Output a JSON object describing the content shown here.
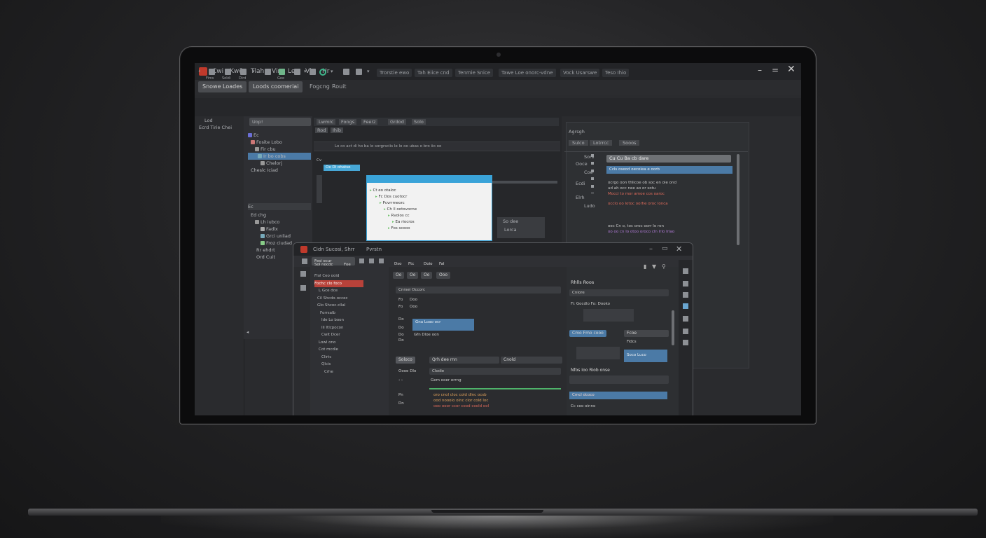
{
  "main_window": {
    "menu": [
      "Cwi",
      "Kwön",
      "Tlah",
      "Vin",
      "Len",
      "Vin",
      "Hr"
    ],
    "tabs": [
      "Snowe Loades",
      "Loods coomeriai",
      "Fogcng",
      "Rouit"
    ],
    "toolbar_labels": [
      "Fims",
      "Soldi",
      "Dlrd",
      "Gee"
    ],
    "toolbar_dropdowns": [
      "Trorstie ewo",
      "Tah Eiice cnd",
      "Tenmie Snice",
      "Tawe Loe onorc-vdne",
      "Vock Usarswe",
      "Teso Ihio"
    ],
    "left_pane": [
      "Lod",
      "Ecrd Tirie Chei"
    ],
    "tree_header": "Uop!",
    "tree_rows": [
      "Ec",
      "Fosite Lobo",
      "Fir cbu",
      "Ir bo cobs",
      "Chelorj",
      "Cheslc  Iciad"
    ],
    "tree_section": "Ec",
    "tree_rows2": [
      "Ed chg",
      "Lh iubco",
      "Fadlx",
      "Grci unliad",
      "Froz ciudad",
      "Rr ehdrt",
      "Ord Cuit"
    ],
    "editor_tabs": [
      "Lwmrc",
      "Fongs",
      "Feerz",
      "Grdod",
      "Solo"
    ],
    "editor_subtabs": [
      "Rod",
      "Ihib"
    ],
    "editor_path": "Lo  co  act  di  ho ba  lo sorgrsciis  le    lo  oo  ubas  o  bro  iio  oo",
    "editor_selection": "Ox Dl ohatso",
    "popup_rows": [
      "Ct eo otaloc",
      "Fc Dos cuotocr",
      "Pcvrrmeorc",
      "Ch ll ootovocne",
      "Rvolos   cc",
      "Ea riocros",
      "Fos scooo"
    ],
    "mid_pane": [
      "So dee",
      "Lorca"
    ],
    "right_panel": {
      "title": "Agrsgh",
      "tabs": [
        "Sulco",
        "Lotrrcc",
        "Sooos"
      ],
      "labels": [
        "Sors",
        "Ooce",
        "Coe",
        "Ecdi",
        "Elrh",
        "Ludo"
      ],
      "field": "Cu Cu Ba cb dare",
      "selected": "Ccls oseod oecoiea e oorb",
      "body_lines": [
        "ocrgo oon thlicoe ob soc  en ole  ond",
        "ud ah occ nee ao or sotu",
        "Mocci to mor amoe cos oaroc",
        "occlo oo lotoc oorhe oroc lonca",
        "oec Cn o, toc oroc oorr  lo ron",
        "oo oo cn lo otoo oroco cln  lrlo lrlao"
      ]
    },
    "icons": [
      "app-icon",
      "minimize-icon",
      "maximize-icon",
      "close-icon"
    ]
  },
  "inner_window": {
    "title": "Cidn Sucosi, Shrr",
    "title_suffix": "Pvrstn",
    "toolbar_drop": "Fesi ocur",
    "tree_tabs": [
      "Sol nocdc",
      "Foe"
    ],
    "tree_rows": [
      "Flol Ceo ooid",
      "Fochc clo foco",
      "L  Gce dce",
      "Cil Shcdo-occec",
      "Glo Shcoc-cllal",
      "Forrsalb",
      "Ide Lo boon",
      "Ili Itlcpocon",
      "Cwlt Dcer",
      "Lowl ono",
      "Cot mcdle",
      "Clirtc",
      "Qlcis",
      "Crhe"
    ],
    "center_menu": [
      "Dso",
      "Ftc",
      "Doio",
      "Fal"
    ],
    "center_buttons": [
      "Oo",
      "Oo",
      "Oo",
      "Ooo"
    ],
    "center_dropdown": "Cnrsei Occorc",
    "center_rows": [
      {
        "k": "Fo",
        "v": "Doo"
      },
      {
        "k": "Fo",
        "v": "Ooo"
      },
      {
        "k": "Do",
        "v": ""
      },
      {
        "k": "Do",
        "v": "Gna Loao ocr"
      },
      {
        "k": "Do",
        "v": "Gfn Dloe oon"
      },
      {
        "k": "Do",
        "v": ""
      }
    ],
    "center_tabs": [
      "Soloco",
      "Qrh dee rnn",
      "Cnold"
    ],
    "center_section": "Oooe Dlo",
    "center_field": "Clodie",
    "center_cmd": "Gem ooer errng",
    "center_code": [
      "oro cnol cloc cold dlnc ocsb",
      "ood nooolo olnc clor cold loc",
      "ooo ooor ccor cood coold ool"
    ],
    "center_code_labels": [
      "Pn",
      "Dn"
    ],
    "right_title": "Rhlls Roos",
    "right_field": "Cniore",
    "right_row": "Fi:   Gocdlo   Fo:   Dooko",
    "right_btn1": "Cmo Fmo cooo",
    "right_btn2": "Fcoe",
    "right_tag": "Fidcs",
    "right_box": "Soco Luco",
    "right_section": "Nfos Ioo Riob onse",
    "right_selected": "Cmcl dcoco",
    "right_last": "Cc coo oinno",
    "icons": [
      "app-icon",
      "minimize-icon",
      "maximize-icon",
      "close-icon"
    ]
  },
  "colors": {
    "accent_blue": "#4b7aa6",
    "accent_cyan": "#3aa3d8",
    "app_red": "#c0392b",
    "status_green": "#3fb58a"
  }
}
